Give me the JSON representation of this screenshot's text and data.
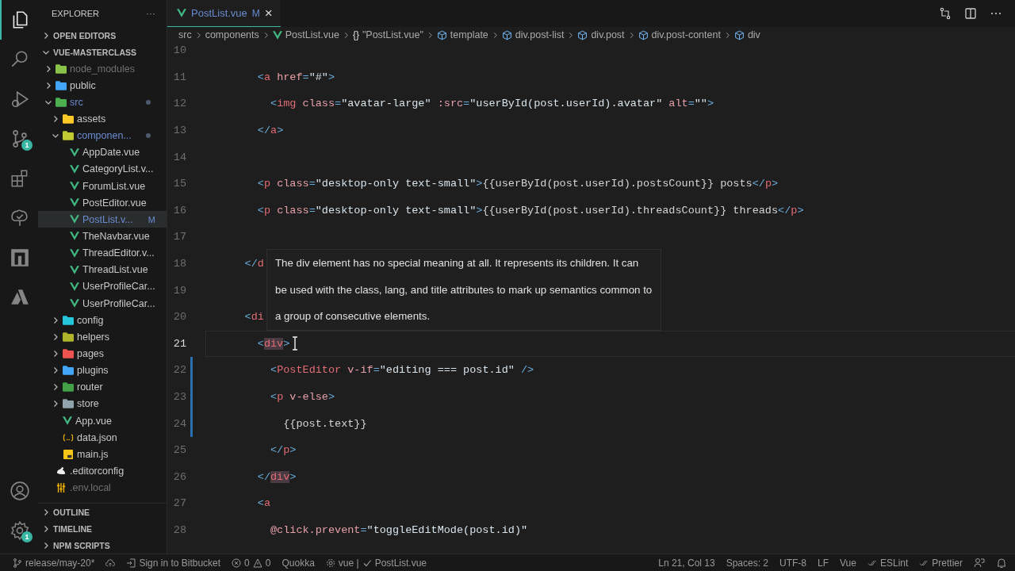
{
  "activity_bar": {
    "items": [
      {
        "kind": "files",
        "selected": true
      },
      {
        "kind": "search",
        "selected": false
      },
      {
        "kind": "debug",
        "selected": false
      },
      {
        "kind": "source_control",
        "selected": false,
        "badge": "1"
      },
      {
        "kind": "extensions",
        "selected": false
      },
      {
        "kind": "testing",
        "selected": false
      },
      {
        "kind": "remote",
        "selected": false
      },
      {
        "kind": "azure",
        "selected": false
      }
    ],
    "bottom": [
      {
        "kind": "account"
      },
      {
        "kind": "settings",
        "badge": "1"
      }
    ]
  },
  "sidebar": {
    "title": "EXPLORER",
    "menu": "···",
    "sections_top": [
      {
        "label": "OPEN EDITORS",
        "expanded": false
      },
      {
        "label": "VUE-MASTERCLASS",
        "expanded": true
      }
    ],
    "tree": [
      {
        "label": "node_modules",
        "kind": "folder",
        "color": "#8bc34a",
        "expanded": false,
        "ignored": true,
        "modified": false,
        "selected": false
      },
      {
        "label": "public",
        "kind": "folder",
        "color": "#42a5f5",
        "expanded": false,
        "ignored": false,
        "modified": false,
        "selected": false
      },
      {
        "label": "src",
        "kind": "folder",
        "color": "#4caf50",
        "expanded": true,
        "ignored": false,
        "modified": true,
        "selected": false,
        "children": [
          {
            "label": "assets",
            "kind": "folder",
            "color": "#ffca28",
            "expanded": false,
            "ignored": false,
            "modified": false,
            "selected": false
          },
          {
            "label": "componen...",
            "kind": "folder",
            "color": "#c0ca33",
            "expanded": true,
            "ignored": false,
            "modified": true,
            "selected": false,
            "children": [
              {
                "label": "AppDate.vue",
                "kind": "vue",
                "ignored": false,
                "modified": false,
                "selected": false
              },
              {
                "label": "CategoryList.v...",
                "kind": "vue",
                "ignored": false,
                "modified": false,
                "selected": false
              },
              {
                "label": "ForumList.vue",
                "kind": "vue",
                "ignored": false,
                "modified": false,
                "selected": false
              },
              {
                "label": "PostEditor.vue",
                "kind": "vue",
                "ignored": false,
                "modified": false,
                "selected": false
              },
              {
                "label": "PostList.v...",
                "kind": "vue",
                "ignored": false,
                "modified": true,
                "selected": true,
                "badge": "M"
              },
              {
                "label": "TheNavbar.vue",
                "kind": "vue",
                "ignored": false,
                "modified": false,
                "selected": false
              },
              {
                "label": "ThreadEditor.v...",
                "kind": "vue",
                "ignored": false,
                "modified": false,
                "selected": false
              },
              {
                "label": "ThreadList.vue",
                "kind": "vue",
                "ignored": false,
                "modified": false,
                "selected": false
              },
              {
                "label": "UserProfileCar...",
                "kind": "vue",
                "ignored": false,
                "modified": false,
                "selected": false
              },
              {
                "label": "UserProfileCar...",
                "kind": "vue",
                "ignored": false,
                "modified": false,
                "selected": false
              }
            ]
          },
          {
            "label": "config",
            "kind": "folder",
            "color": "#26c6da",
            "expanded": false,
            "ignored": false,
            "modified": false,
            "selected": false
          },
          {
            "label": "helpers",
            "kind": "folder",
            "color": "#afb42b",
            "expanded": false,
            "ignored": false,
            "modified": false,
            "selected": false
          },
          {
            "label": "pages",
            "kind": "folder",
            "color": "#ef5350",
            "expanded": false,
            "ignored": false,
            "modified": false,
            "selected": false
          },
          {
            "label": "plugins",
            "kind": "folder",
            "color": "#42a5f5",
            "expanded": false,
            "ignored": false,
            "modified": false,
            "selected": false
          },
          {
            "label": "router",
            "kind": "folder",
            "color": "#43a047",
            "expanded": false,
            "ignored": false,
            "modified": false,
            "selected": false
          },
          {
            "label": "store",
            "kind": "folder",
            "color": "#90a4ae",
            "expanded": false,
            "ignored": false,
            "modified": false,
            "selected": false
          },
          {
            "label": "App.vue",
            "kind": "vue",
            "ignored": false,
            "modified": false,
            "selected": false
          },
          {
            "label": "data.json",
            "kind": "json",
            "ignored": false,
            "modified": false,
            "selected": false
          },
          {
            "label": "main.js",
            "kind": "js",
            "ignored": false,
            "modified": false,
            "selected": false
          }
        ]
      },
      {
        "label": ".editorconfig",
        "kind": "editorconfig",
        "ignored": false,
        "modified": false,
        "selected": false
      },
      {
        "label": ".env.local",
        "kind": "env",
        "ignored": true,
        "modified": false,
        "selected": false
      }
    ],
    "sections_bottom": [
      {
        "label": "OUTLINE",
        "expanded": false
      },
      {
        "label": "TIMELINE",
        "expanded": false
      },
      {
        "label": "NPM SCRIPTS",
        "expanded": false
      }
    ]
  },
  "editor": {
    "tabs": [
      {
        "label": "PostList.vue",
        "badge": "M",
        "selected": true,
        "close": "×"
      }
    ],
    "breadcrumbs": [
      {
        "kind": "folder",
        "label": "src"
      },
      {
        "kind": "folder",
        "label": "components"
      },
      {
        "kind": "vue",
        "label": "PostList.vue"
      },
      {
        "kind": "object",
        "label": "\"PostList.vue\"",
        "icon_text": "{}"
      },
      {
        "kind": "element",
        "label": "template"
      },
      {
        "kind": "element",
        "label": "div.post-list"
      },
      {
        "kind": "element",
        "label": "div.post"
      },
      {
        "kind": "element",
        "label": "div.post-content"
      },
      {
        "kind": "element",
        "label": "div"
      }
    ],
    "lines": [
      {
        "number": "10",
        "current": false,
        "changed": false
      },
      {
        "number": "11",
        "current": false,
        "changed": false,
        "tokens": [
          {
            "kind": "punct",
            "text": "        <"
          },
          {
            "kind": "tag",
            "text": "a"
          },
          {
            "kind": "attr",
            "text": " href"
          },
          {
            "kind": "punct",
            "text": "="
          },
          {
            "kind": "str",
            "text": "\"#\""
          },
          {
            "kind": "punct",
            "text": ">"
          }
        ]
      },
      {
        "number": "12",
        "current": false,
        "changed": false,
        "tokens": [
          {
            "kind": "punct",
            "text": "          <"
          },
          {
            "kind": "tag",
            "text": "img"
          },
          {
            "kind": "attr",
            "text": " class"
          },
          {
            "kind": "punct",
            "text": "="
          },
          {
            "kind": "str",
            "text": "\"avatar-large\""
          },
          {
            "kind": "attr",
            "text": " :src"
          },
          {
            "kind": "punct",
            "text": "="
          },
          {
            "kind": "str",
            "text": "\"userById(post.userId).avatar\""
          },
          {
            "kind": "attr",
            "text": " alt"
          },
          {
            "kind": "punct",
            "text": "="
          },
          {
            "kind": "str",
            "text": "\"\""
          },
          {
            "kind": "punct",
            "text": ">"
          }
        ]
      },
      {
        "number": "13",
        "current": false,
        "changed": false,
        "tokens": [
          {
            "kind": "punct",
            "text": "        </"
          },
          {
            "kind": "tag",
            "text": "a"
          },
          {
            "kind": "punct",
            "text": ">"
          }
        ]
      },
      {
        "number": "14",
        "current": false,
        "changed": false
      },
      {
        "number": "15",
        "current": false,
        "changed": false,
        "tokens": [
          {
            "kind": "punct",
            "text": "        <"
          },
          {
            "kind": "tag",
            "text": "p"
          },
          {
            "kind": "attr",
            "text": " class"
          },
          {
            "kind": "punct",
            "text": "="
          },
          {
            "kind": "str",
            "text": "\"desktop-only text-small\""
          },
          {
            "kind": "punct",
            "text": ">"
          },
          {
            "kind": "text",
            "text": "{{userById(post.userId).postsCount}} posts"
          },
          {
            "kind": "punct",
            "text": "</"
          },
          {
            "kind": "tag",
            "text": "p"
          },
          {
            "kind": "punct",
            "text": ">"
          }
        ]
      },
      {
        "number": "16",
        "current": false,
        "changed": false,
        "tokens": [
          {
            "kind": "punct",
            "text": "        <"
          },
          {
            "kind": "tag",
            "text": "p"
          },
          {
            "kind": "attr",
            "text": " class"
          },
          {
            "kind": "punct",
            "text": "="
          },
          {
            "kind": "str",
            "text": "\"desktop-only text-small\""
          },
          {
            "kind": "punct",
            "text": ">"
          },
          {
            "kind": "text",
            "text": "{{userById(post.userId).threadsCount}} threads"
          },
          {
            "kind": "punct",
            "text": "</"
          },
          {
            "kind": "tag",
            "text": "p"
          },
          {
            "kind": "punct",
            "text": ">"
          }
        ]
      },
      {
        "number": "17",
        "current": false,
        "changed": false
      },
      {
        "number": "18",
        "current": false,
        "changed": false,
        "tokens": [
          {
            "kind": "punct",
            "text": "      </"
          },
          {
            "kind": "tag",
            "text": "d"
          }
        ]
      },
      {
        "number": "19",
        "current": false,
        "changed": false
      },
      {
        "number": "20",
        "current": false,
        "changed": false,
        "tokens": [
          {
            "kind": "punct",
            "text": "      <"
          },
          {
            "kind": "tag",
            "text": "di"
          }
        ]
      },
      {
        "number": "21",
        "current": true,
        "changed": false,
        "tokens": [
          {
            "kind": "punct",
            "text": "        <"
          },
          {
            "kind": "tag",
            "text": "div",
            "match": true
          },
          {
            "kind": "punct",
            "text": ">"
          }
        ]
      },
      {
        "number": "22",
        "current": false,
        "changed": true,
        "tokens": [
          {
            "kind": "punct",
            "text": "          <"
          },
          {
            "kind": "tag",
            "text": "PostEditor"
          },
          {
            "kind": "attr",
            "text": " v-if"
          },
          {
            "kind": "punct",
            "text": "="
          },
          {
            "kind": "str",
            "text": "\"editing === post.id\""
          },
          {
            "kind": "punct",
            "text": " />"
          }
        ]
      },
      {
        "number": "23",
        "current": false,
        "changed": true,
        "tokens": [
          {
            "kind": "punct",
            "text": "          <"
          },
          {
            "kind": "tag",
            "text": "p"
          },
          {
            "kind": "attr",
            "text": " v-else"
          },
          {
            "kind": "punct",
            "text": ">"
          }
        ]
      },
      {
        "number": "24",
        "current": false,
        "changed": true,
        "tokens": [
          {
            "kind": "text",
            "text": "            {{post.text}}"
          }
        ]
      },
      {
        "number": "25",
        "current": false,
        "changed": false,
        "tokens": [
          {
            "kind": "punct",
            "text": "          </"
          },
          {
            "kind": "tag",
            "text": "p"
          },
          {
            "kind": "punct",
            "text": ">"
          }
        ]
      },
      {
        "number": "26",
        "current": false,
        "changed": false,
        "tokens": [
          {
            "kind": "punct",
            "text": "        </"
          },
          {
            "kind": "tag",
            "text": "div",
            "match": true
          },
          {
            "kind": "punct",
            "text": ">"
          }
        ]
      },
      {
        "number": "27",
        "current": false,
        "changed": false,
        "tokens": [
          {
            "kind": "punct",
            "text": "        <"
          },
          {
            "kind": "tag",
            "text": "a"
          }
        ]
      },
      {
        "number": "28",
        "current": false,
        "changed": false,
        "tokens": [
          {
            "kind": "attr",
            "text": "          @click.prevent"
          },
          {
            "kind": "punct",
            "text": "="
          },
          {
            "kind": "str",
            "text": "\"toggleEditMode(post.id)\""
          }
        ]
      }
    ],
    "hover_tooltip": "The div element has no special meaning at all. It represents its children. It can be used with the class, lang, and title attributes to mark up semantics common to a group of consecutive elements."
  },
  "status_bar": {
    "left": [
      {
        "kind": "branch",
        "text": "release/may-20*"
      },
      {
        "kind": "sync"
      },
      {
        "kind": "account",
        "text": "Sign in to Bitbucket"
      },
      {
        "kind": "problems",
        "errors": "0",
        "warnings": "0"
      },
      {
        "kind": "plain",
        "text": "Quokka"
      },
      {
        "kind": "vue",
        "text": "vue |",
        "file": "PostList.vue"
      }
    ],
    "right": [
      {
        "kind": "plain",
        "text": "Ln 21, Col 13"
      },
      {
        "kind": "plain",
        "text": "Spaces: 2"
      },
      {
        "kind": "plain",
        "text": "UTF-8"
      },
      {
        "kind": "plain",
        "text": "LF"
      },
      {
        "kind": "plain",
        "text": "Vue"
      },
      {
        "kind": "check",
        "text": "ESLint"
      },
      {
        "kind": "check",
        "text": "Prettier"
      },
      {
        "kind": "feedback"
      },
      {
        "kind": "bell"
      }
    ]
  }
}
